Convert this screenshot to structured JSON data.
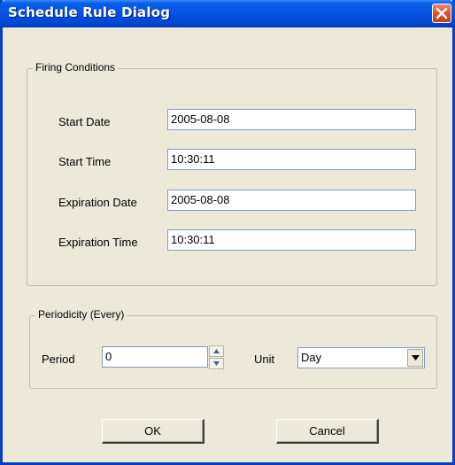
{
  "window": {
    "title": "Schedule Rule Dialog",
    "close_icon": "close-icon",
    "close_color": "#d8542d",
    "titlebar_color": "#0453e0"
  },
  "firing_conditions": {
    "legend": "Firing Conditions",
    "start_date": {
      "label": "Start Date",
      "value": "2005-08-08"
    },
    "start_time": {
      "label": "Start Time",
      "value": "10:30:11"
    },
    "expiration_date": {
      "label": "Expiration Date",
      "value": "2005-08-08"
    },
    "expiration_time": {
      "label": "Expiration Time",
      "value": "10:30:11"
    }
  },
  "periodicity": {
    "legend": "Periodicity (Every)",
    "period": {
      "label": "Period",
      "value": "0"
    },
    "unit": {
      "label": "Unit",
      "selected": "Day"
    }
  },
  "buttons": {
    "ok": "OK",
    "cancel": "Cancel"
  }
}
